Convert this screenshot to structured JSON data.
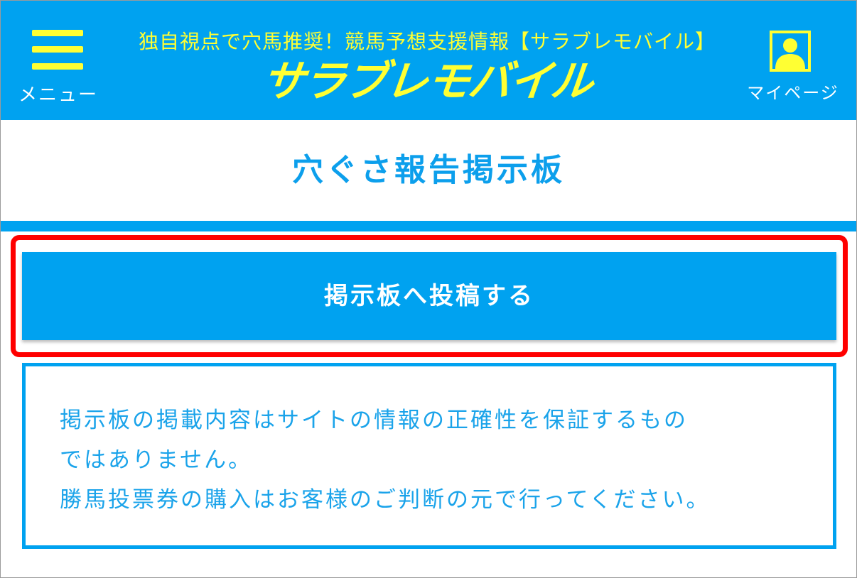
{
  "header": {
    "menu_label": "メニュー",
    "tagline": "独自視点で穴馬推奨！競馬予想支援情報【サラブレモバイル】",
    "logo": "サラブレモバイル",
    "mypage_label": "マイページ",
    "icons": {
      "menu": "hamburger-icon",
      "mypage": "user-profile-icon"
    }
  },
  "main": {
    "title": "穴ぐさ報告掲示板",
    "post_button_label": "掲示板へ投稿する",
    "notice": {
      "line1": "掲示板の掲載内容はサイトの情報の正確性を保証するもの",
      "line2": "ではありません。",
      "line3": "勝馬投票券の購入はお客様のご判断の元で行ってください。"
    }
  },
  "colors": {
    "brand_blue": "#00a2f0",
    "brand_yellow": "#ffff33",
    "highlight_red": "#ff0000"
  }
}
